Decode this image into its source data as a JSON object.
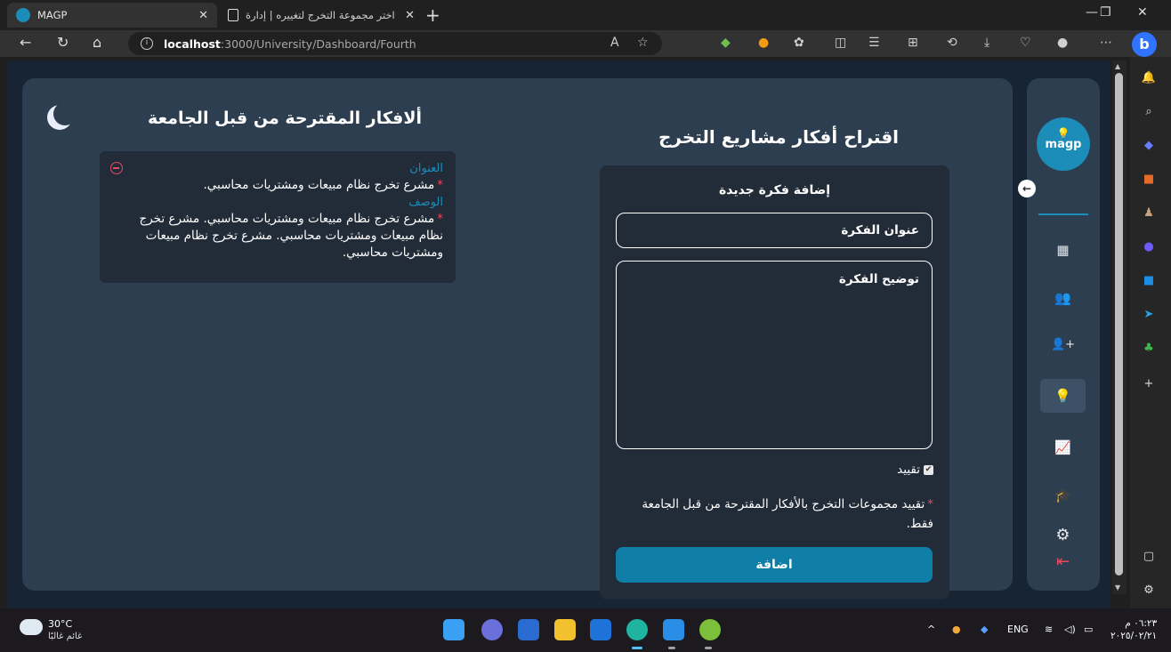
{
  "browser": {
    "tabs": [
      {
        "title": "MAGP",
        "active": true
      },
      {
        "title": "اختر مجموعة التخرج لتغييره | إدارة",
        "active": false
      }
    ],
    "url_host": "localhost",
    "url_path": ":3000/University/Dashboard/Fourth",
    "profile_icon": "bing-icon"
  },
  "sidebar": {
    "logo_text": "magp",
    "items": [
      {
        "name": "dashboard-grid-icon",
        "glyph": "▦"
      },
      {
        "name": "groups-icon",
        "glyph": "👥"
      },
      {
        "name": "add-user-icon",
        "glyph": "👤+"
      },
      {
        "name": "lightbulb-icon",
        "glyph": "💡"
      },
      {
        "name": "chart-icon",
        "glyph": "📈"
      },
      {
        "name": "graduation-cap-icon",
        "glyph": "🎓"
      },
      {
        "name": "settings-gear-icon",
        "glyph": "⚙"
      },
      {
        "name": "logout-icon",
        "glyph": "⇤"
      }
    ]
  },
  "suggested": {
    "title": "ألافكار المقترحة من قبل الجامعة",
    "ideas": [
      {
        "title_label": "العنوان",
        "title": "مشرع تخرج نظام مبيعات ومشتريات محاسبي.",
        "desc_label": "الوصف",
        "desc": "مشرع تخرج نظام مبيعات ومشتريات محاسبي. مشرع تخرج نظام مبيعات ومشتريات محاسبي. مشرع تخرج نظام مبيعات ومشتريات محاسبي."
      }
    ]
  },
  "form": {
    "page_title": "اقتراح أفكار مشاريع التخرج",
    "card_title": "إضافة فكرة جديدة",
    "title_placeholder": "عنوان الفكرة",
    "desc_placeholder": "توضيح الفكرة",
    "restrict_label": "تقييد",
    "restrict_checked": true,
    "note": "تقييد مجموعات التخرج بالأفكار المقترحة من قبل الجامعة فقط.",
    "submit_label": "اضافة"
  },
  "taskbar": {
    "temperature": "30°C",
    "condition": "غائم غالبًا",
    "language": "ENG",
    "time": "٠٦:٢٣ م",
    "date": "٢٠٢٥/٠٢/٢١"
  },
  "colors": {
    "accent": "#1c8db8",
    "danger": "#e84a5f",
    "panel": "#2c3e50",
    "page_bg": "#172434",
    "card": "#222b38"
  }
}
